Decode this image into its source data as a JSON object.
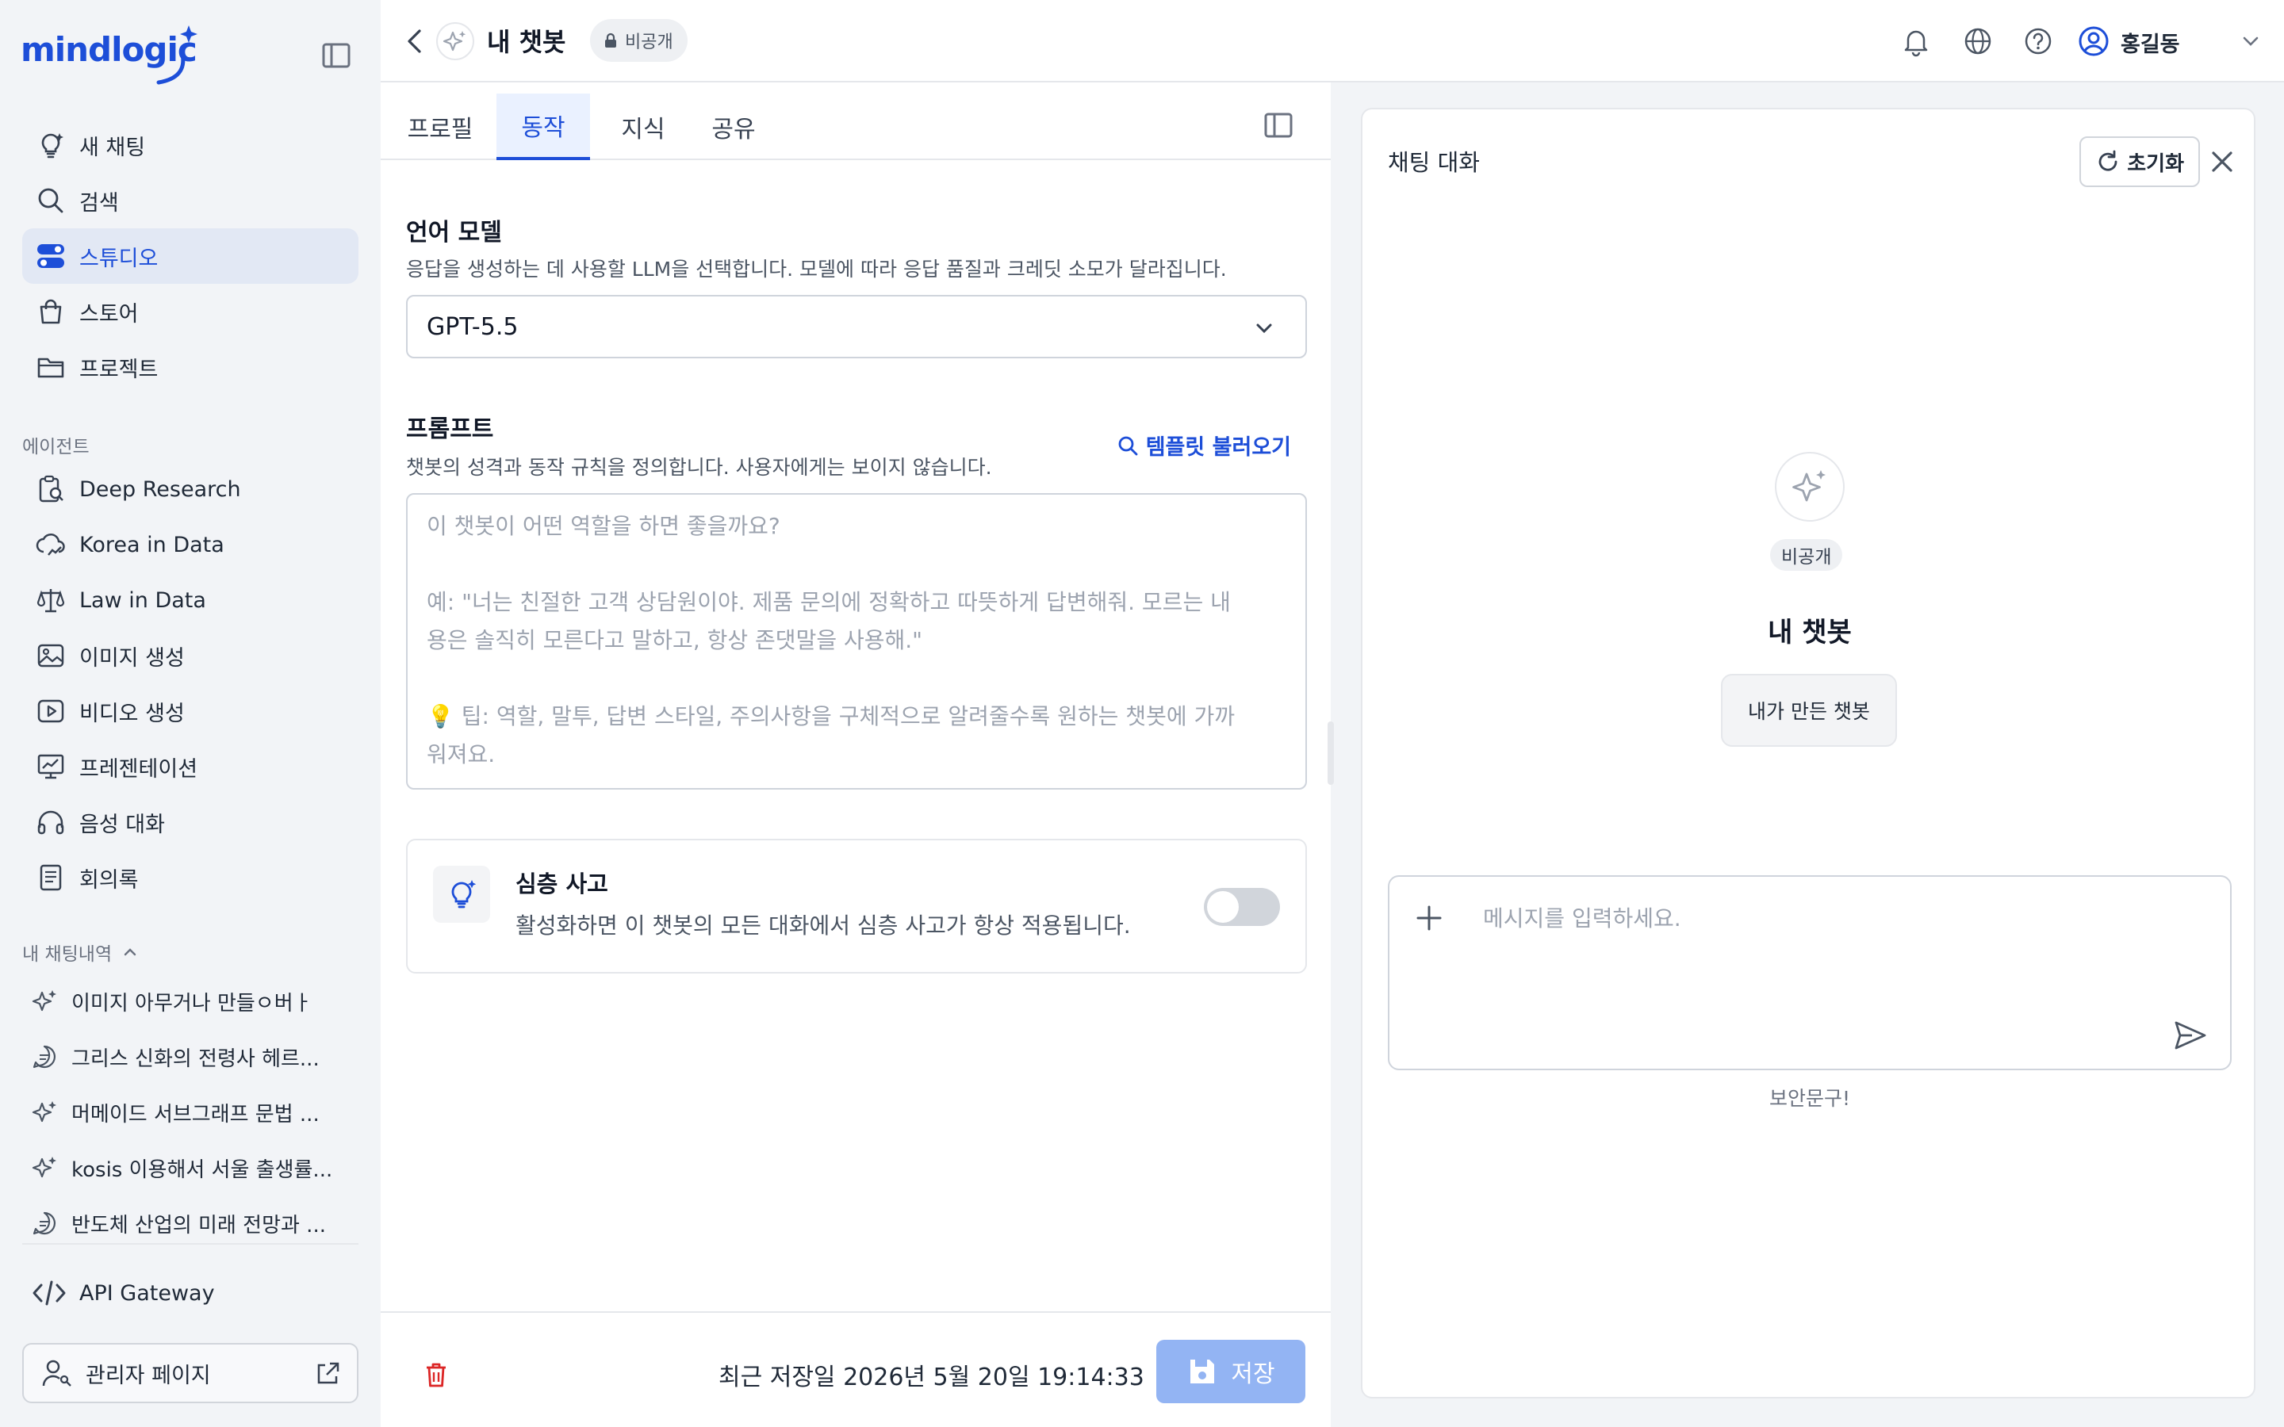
{
  "brand": {
    "name": "mindlogic"
  },
  "sidebar": {
    "nav": [
      {
        "label": "새 채팅",
        "icon": "lightbulb-sparkle-icon"
      },
      {
        "label": "검색",
        "icon": "search-icon"
      },
      {
        "label": "스튜디오",
        "icon": "studio-toggle-icon",
        "active": true
      },
      {
        "label": "스토어",
        "icon": "shopping-bag-icon"
      },
      {
        "label": "프로젝트",
        "icon": "folder-icon"
      }
    ],
    "agents_label": "에이전트",
    "agents": [
      {
        "label": "Deep Research",
        "icon": "research-clipboard-icon"
      },
      {
        "label": "Korea in Data",
        "icon": "cloud-chart-icon"
      },
      {
        "label": "Law in Data",
        "icon": "scales-icon"
      },
      {
        "label": "이미지 생성",
        "icon": "image-icon"
      },
      {
        "label": "비디오 생성",
        "icon": "video-play-icon"
      },
      {
        "label": "프레젠테이션",
        "icon": "presentation-icon"
      },
      {
        "label": "음성 대화",
        "icon": "headphones-icon"
      },
      {
        "label": "회의록",
        "icon": "document-lines-icon"
      }
    ],
    "history_label": "내 채팅내역",
    "history": [
      {
        "label": "이미지 아무거나 만들ㅇ버ㅏ",
        "icon": "sparkle-icon"
      },
      {
        "label": "그리스 신화의 전령사 헤르...",
        "icon": "chat-bubble-icon"
      },
      {
        "label": "머메이드 서브그래프 문법 ...",
        "icon": "sparkle-icon"
      },
      {
        "label": "kosis 이용해서 서울 출생률...",
        "icon": "sparkle-icon"
      },
      {
        "label": "반도체 산업의 미래 전망과 ...",
        "icon": "chat-bubble-icon"
      }
    ],
    "api_gateway": "API Gateway",
    "admin_page": "관리자 페이지"
  },
  "topbar": {
    "bot_name": "내 챗봇",
    "visibility": "비공개",
    "user_name": "홍길동"
  },
  "editor": {
    "tabs": [
      {
        "label": "프로필"
      },
      {
        "label": "동작",
        "active": true
      },
      {
        "label": "지식"
      },
      {
        "label": "공유"
      }
    ],
    "model": {
      "title": "언어 모델",
      "desc": "응답을 생성하는 데 사용할 LLM을 선택합니다. 모델에 따라 응답 품질과 크레딧 소모가 달라집니다.",
      "selected": "GPT-5.5"
    },
    "prompt": {
      "title": "프롬프트",
      "desc": "챗봇의 성격과 동작 규칙을 정의합니다. 사용자에게는 보이지 않습니다.",
      "template_link": "템플릿 불러오기",
      "placeholder_1": "이 챗봇이 어떤 역할을 하면 좋을까요?",
      "placeholder_2a": "예: \"너는 친절한 고객 상담원이야. 제품 문의에 정확하고 따뜻하게 답변해줘. 모르는 내",
      "placeholder_2b": "용은 솔직히 모른다고 말하고, 항상 존댓말을 사용해.\"",
      "placeholder_3a": "팁: 역할, 말투, 답변 스타일, 주의사항을 구체적으로 알려줄수록 원하는 챗봇에 가까",
      "placeholder_3b": "워져요."
    },
    "deep_thinking": {
      "title": "심층 사고",
      "desc": "활성화하면 이 챗봇의 모든 대화에서 심층 사고가 항상 적용됩니다.",
      "enabled": false
    },
    "footer": {
      "saved_text": "최근 저장일 2026년 5월 20일 19:14:33",
      "save_label": "저장"
    }
  },
  "chat": {
    "title": "채팅 대화",
    "reset_label": "초기화",
    "bot_visibility": "비공개",
    "bot_name": "내 챗봇",
    "bot_desc": "내가 만든 챗봇",
    "input_placeholder": "메시지를 입력하세요.",
    "security_note": "보안문구!"
  },
  "colors": {
    "accent": "#1d4ed8",
    "save_disabled": "#93b4f3",
    "delete": "#dc2626"
  }
}
